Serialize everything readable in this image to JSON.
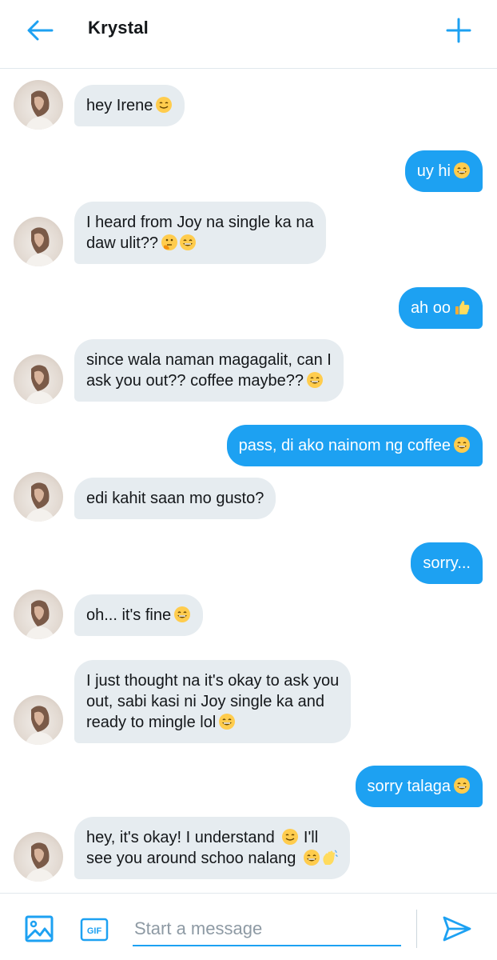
{
  "header": {
    "title": "Krystal",
    "back_icon": "arrow-left-icon",
    "new_icon": "plus-icon",
    "accent": "#1da1f2"
  },
  "messages": [
    {
      "from": "them",
      "lines": [
        "hey Irene"
      ],
      "emoji": [
        "smile"
      ]
    },
    {
      "from": "me",
      "lines": [
        "uy hi"
      ],
      "emoji": [
        "grin"
      ]
    },
    {
      "from": "them",
      "lines": [
        "I heard from Joy na single ka na",
        "daw ulit??"
      ],
      "emoji": [
        "thinking",
        "grin"
      ]
    },
    {
      "from": "me",
      "lines": [
        "ah oo"
      ],
      "emoji": [
        "thumbs-up"
      ]
    },
    {
      "from": "them",
      "lines": [
        "since wala naman magagalit, can I",
        "ask you out?? coffee maybe??"
      ],
      "emoji": [
        "grin"
      ]
    },
    {
      "from": "me",
      "lines": [
        "pass, di ako nainom ng coffee"
      ],
      "emoji": [
        "grin"
      ]
    },
    {
      "from": "them",
      "lines": [
        "edi kahit saan mo gusto?"
      ],
      "emoji": []
    },
    {
      "from": "me",
      "lines": [
        "sorry..."
      ],
      "emoji": []
    },
    {
      "from": "them",
      "lines": [
        "oh... it's fine"
      ],
      "emoji": [
        "grin"
      ]
    },
    {
      "from": "them",
      "lines": [
        "I just thought na it's okay to ask you",
        "out, sabi kasi ni Joy single ka and",
        "ready to mingle lol"
      ],
      "emoji": [
        "grin"
      ]
    },
    {
      "from": "me",
      "lines": [
        "sorry talaga"
      ],
      "emoji": [
        "grin"
      ]
    },
    {
      "from": "them",
      "lines": [
        "hey, it's okay! I understand",
        "see you around schoo nalang"
      ],
      "emoji": [
        "smile",
        "grin",
        "wave"
      ],
      "segments": [
        [
          "hey, it's okay! I understand ",
          "smile",
          " I'll"
        ],
        [
          "see you around schoo nalang ",
          "grin",
          "wave"
        ]
      ]
    }
  ],
  "composer": {
    "placeholder": "Start a message",
    "image_icon": "image-icon",
    "gif_label": "GIF",
    "send_icon": "send-icon"
  }
}
